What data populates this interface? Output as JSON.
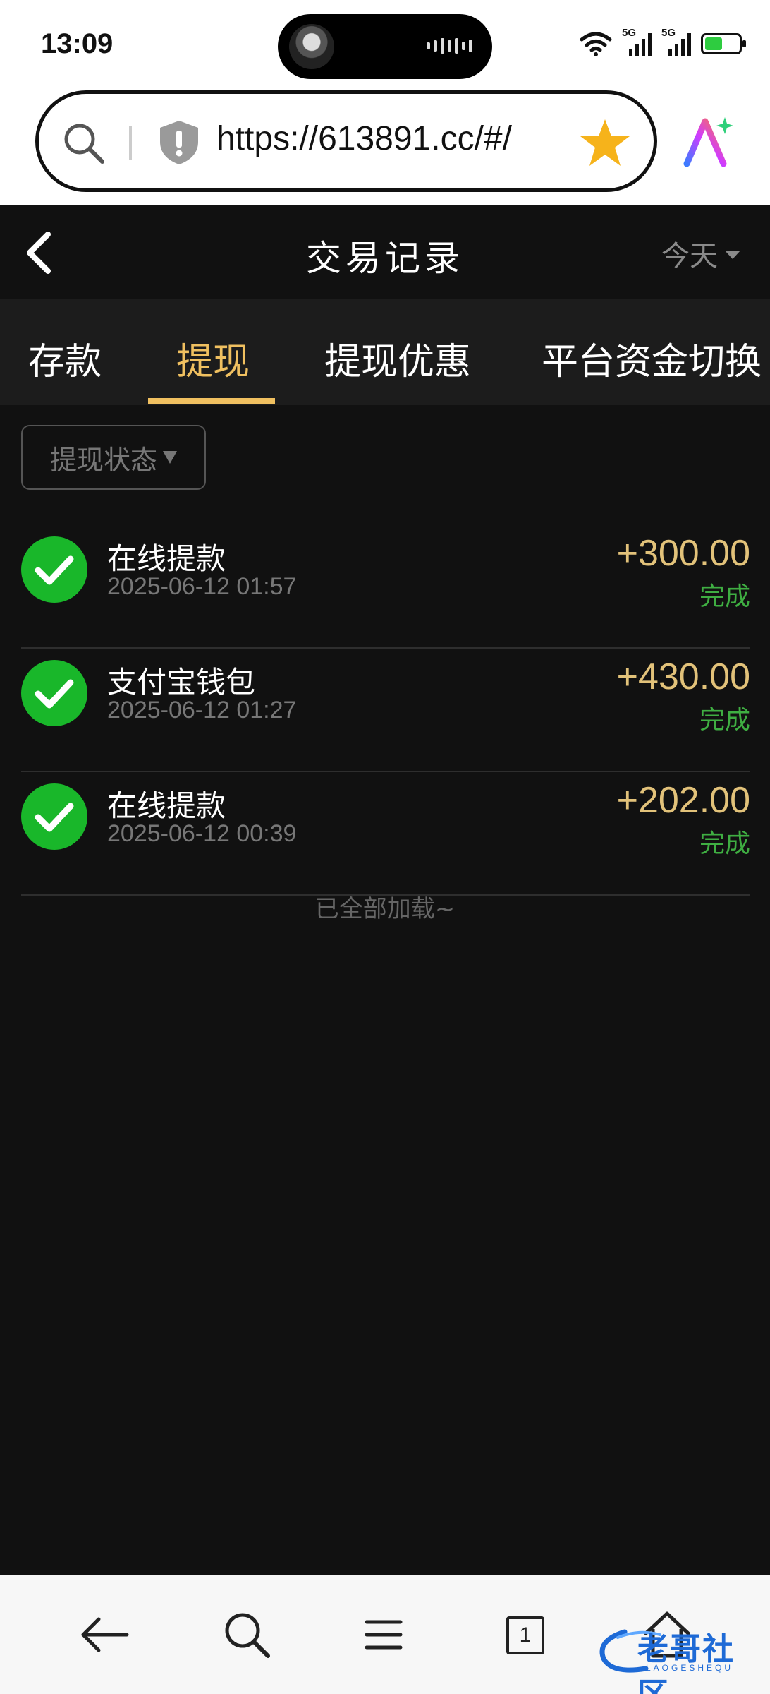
{
  "status_bar": {
    "time": "13:09",
    "network_labels": [
      "5G",
      "5G"
    ],
    "battery_color": "#2ecc40"
  },
  "browser": {
    "url": "https://613891.cc/#/",
    "icons": [
      "search-icon",
      "shield-icon",
      "star-icon",
      "ai-assistant-icon"
    ]
  },
  "header": {
    "title": "交易记录",
    "date_filter": "今天"
  },
  "tabs": [
    {
      "label": "存款",
      "active": false
    },
    {
      "label": "提现",
      "active": true
    },
    {
      "label": "提现优惠",
      "active": false
    },
    {
      "label": "平台资金切换",
      "active": false
    }
  ],
  "filter": {
    "label": "提现状态"
  },
  "transactions": [
    {
      "name": "在线提款",
      "time": "2025-06-12 01:57",
      "amount": "+300.00",
      "status": "完成"
    },
    {
      "name": "支付宝钱包",
      "time": "2025-06-12 01:27",
      "amount": "+430.00",
      "status": "完成"
    },
    {
      "name": "在线提款",
      "time": "2025-06-12 00:39",
      "amount": "+202.00",
      "status": "完成"
    }
  ],
  "list_end_text": "已全部加载~",
  "bottom_nav": {
    "tab_count": "1",
    "icons": [
      "back-arrow-icon",
      "search-icon",
      "menu-icon",
      "tabs-icon",
      "home-icon"
    ]
  },
  "watermark": {
    "text": "老哥社区",
    "sub": "LAOGESHEQU"
  },
  "colors": {
    "accent": "#f0c060",
    "amount": "#e2c27a",
    "success": "#19b72a",
    "status_text": "#3fae42",
    "background": "#111111"
  }
}
